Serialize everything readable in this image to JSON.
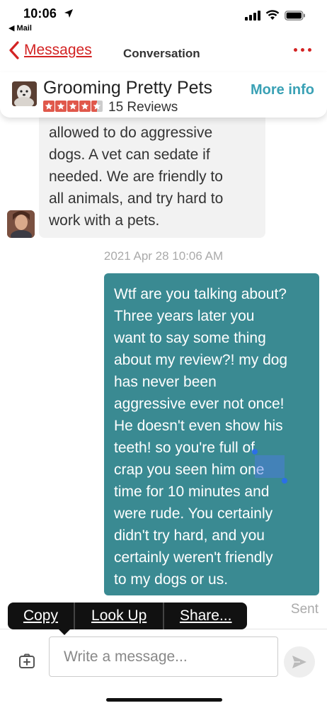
{
  "status_bar": {
    "time": "10:06",
    "back_app": "◀ Mail"
  },
  "nav": {
    "back_label": "Messages",
    "title": "Conversation"
  },
  "business": {
    "name": "Grooming Pretty Pets",
    "rating": 4.5,
    "reviews": "15 Reviews",
    "more_info": "More info",
    "star_color": "#e0584b"
  },
  "messages": {
    "incoming_text": "allowed to do aggressive\ndogs. A vet can sedate if\nneeded. We are friendly to\nall animals, and try hard to\nwork with a pets.",
    "timestamp": "2021 Apr 28 10:06 AM",
    "outgoing_text": "Wtf are you talking about?\nThree years later you\nwant to say some thing\nabout my review?! my dog\nhas never been\naggressive ever not once!\nHe doesn't even show his\nteeth! so you're full of\ncrap you seen him one\ntime for 10 minutes and\nwere rude. You certainly\ndidn't try hard, and you\ncertainly weren't friendly\nto my dogs or us.",
    "outgoing_color": "#3a8a92",
    "sent_label": "Sent"
  },
  "context_menu": {
    "copy": "Copy",
    "look_up": "Look Up",
    "share": "Share..."
  },
  "composer": {
    "placeholder": "Write a message...",
    "attach_icon": "add-photo-icon",
    "send_icon": "send-icon"
  },
  "colors": {
    "accent": "#d32323",
    "link": "#3aa1b5"
  }
}
